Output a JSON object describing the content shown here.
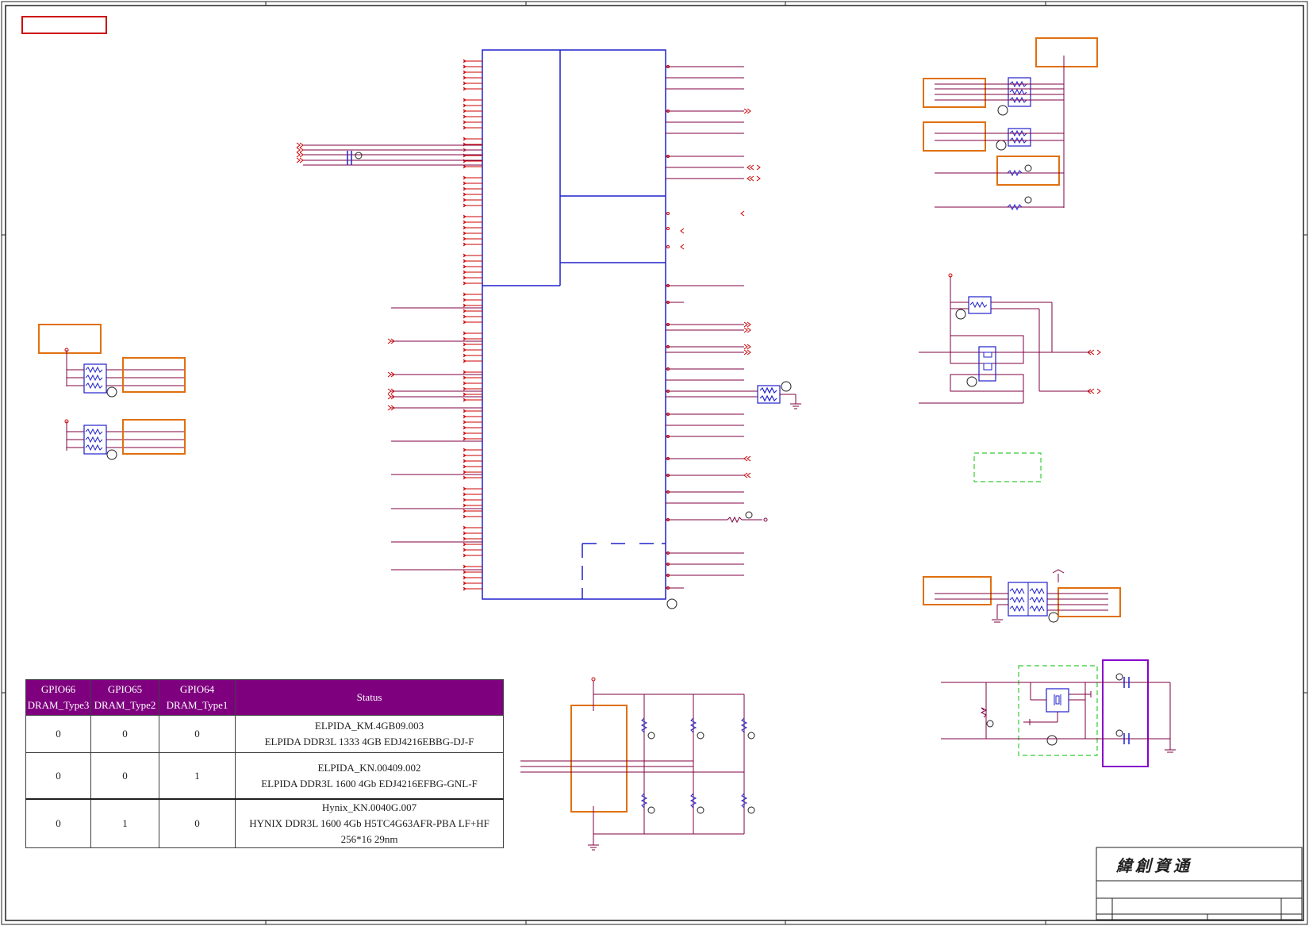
{
  "title_block": {
    "company": "緯創資通"
  },
  "dram_table": {
    "headers": [
      {
        "line1": "GPIO66",
        "line2": "DRAM_Type3"
      },
      {
        "line1": "GPIO65",
        "line2": "DRAM_Type2"
      },
      {
        "line1": "GPIO64",
        "line2": "DRAM_Type1"
      },
      {
        "line1": "Status",
        "line2": ""
      }
    ],
    "rows": [
      {
        "gpio66": "0",
        "gpio65": "0",
        "gpio64": "0",
        "status1": "ELPIDA_KM.4GB09.003",
        "status2": "ELPIDA DDR3L 1333 4GB EDJ4216EBBG-DJ-F"
      },
      {
        "gpio66": "0",
        "gpio65": "0",
        "gpio64": "1",
        "status1": "ELPIDA_KN.00409.002",
        "status2": "ELPIDA DDR3L 1600 4Gb EDJ4216EFBG-GNL-F"
      },
      {
        "gpio66": "0",
        "gpio65": "1",
        "gpio64": "0",
        "status1": "Hynix_KN.0040G.007",
        "status2": "HYNIX DDR3L 1600 4Gb H5TC4G63AFR-PBA LF+HF 256*16 29nm"
      }
    ]
  },
  "colors": {
    "net": "#7f0040",
    "pin": "#cc0000",
    "component": "#2020cc",
    "block": "#e07010",
    "highlight": "#cc0000",
    "keepout": "#33cc33",
    "purple_box": "#8800cc",
    "table_header": "#7f007f"
  },
  "icons": [
    "resistor-icon",
    "ground-icon",
    "capacitor-icon",
    "crystal-icon",
    "resistor-network-icon",
    "connector-arrow-icon"
  ]
}
